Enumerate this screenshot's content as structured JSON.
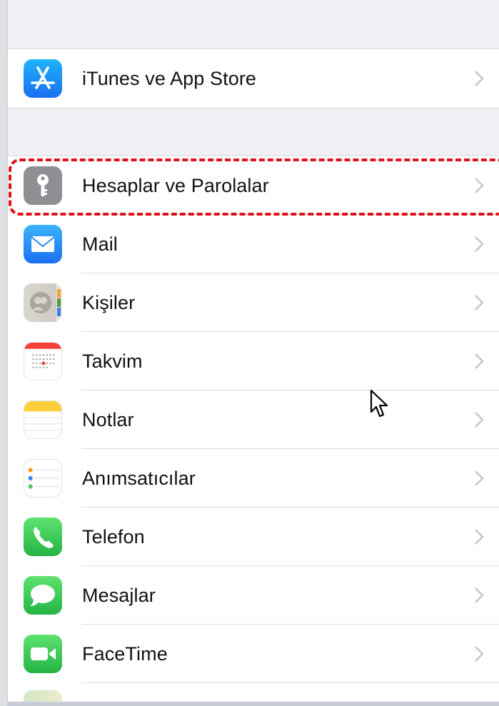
{
  "settings": {
    "items": [
      {
        "label": "iTunes ve App Store",
        "icon": "app-store-icon",
        "color": "#1a8cf7"
      },
      {
        "label": "Hesaplar ve Parolalar",
        "icon": "key-icon",
        "color": "#8e8e93"
      },
      {
        "label": "Mail",
        "icon": "mail-icon",
        "color": "#1f8ff8"
      },
      {
        "label": "Kişiler",
        "icon": "contacts-icon",
        "color": "#c7c4bd"
      },
      {
        "label": "Takvim",
        "icon": "calendar-icon",
        "color": "#ffffff"
      },
      {
        "label": "Notlar",
        "icon": "notes-icon",
        "color": "#ffd23a"
      },
      {
        "label": "Anımsatıcılar",
        "icon": "reminders-icon",
        "color": "#ffffff"
      },
      {
        "label": "Telefon",
        "icon": "phone-icon",
        "color": "#31c553"
      },
      {
        "label": "Mesajlar",
        "icon": "messages-icon",
        "color": "#31c553"
      },
      {
        "label": "FaceTime",
        "icon": "facetime-icon",
        "color": "#31c553"
      }
    ]
  },
  "highlight_color": "#e0101a"
}
